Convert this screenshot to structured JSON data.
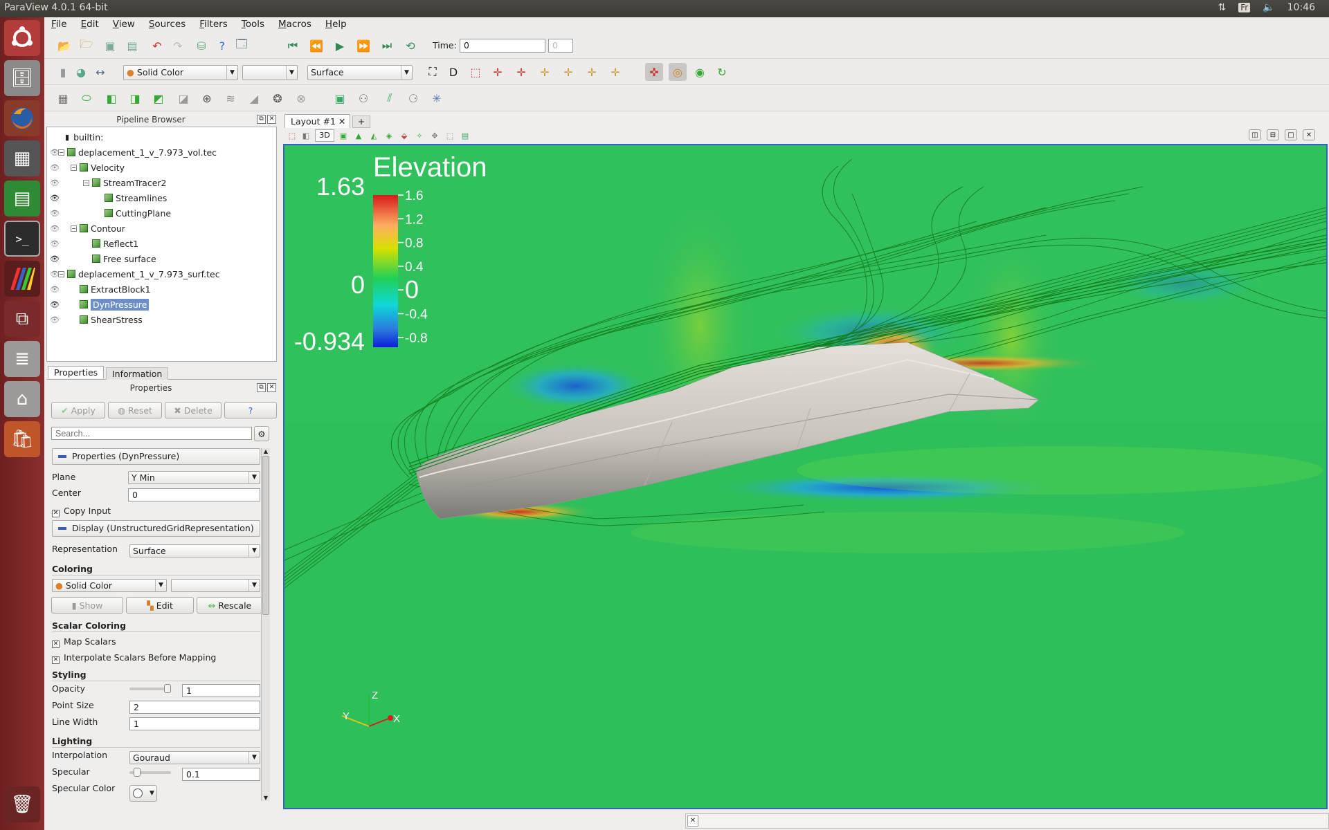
{
  "window_title": "ParaView 4.0.1 64-bit",
  "tray": {
    "network_icon": "updown-arrows-icon",
    "keyboard": "Fr",
    "volume_icon": "speaker-icon",
    "clock": "10:46"
  },
  "menu": [
    "File",
    "Edit",
    "View",
    "Sources",
    "Filters",
    "Tools",
    "Macros",
    "Help"
  ],
  "time": {
    "label": "Time:",
    "value": "0",
    "index": "0"
  },
  "toolbar2": {
    "coloring": "Solid Color",
    "component": "",
    "representation": "Surface"
  },
  "pipeline": {
    "title": "Pipeline Browser",
    "root": "builtin:",
    "items": [
      {
        "label": "deplacement_1_v_7.973_vol.tec",
        "visible": false
      },
      {
        "label": "Velocity",
        "visible": false
      },
      {
        "label": "StreamTracer2",
        "visible": false
      },
      {
        "label": "Streamlines",
        "visible": true
      },
      {
        "label": "CuttingPlane",
        "visible": false
      },
      {
        "label": "Contour",
        "visible": false
      },
      {
        "label": "Reflect1",
        "visible": false
      },
      {
        "label": "Free surface",
        "visible": true
      },
      {
        "label": "deplacement_1_v_7.973_surf.tec",
        "visible": false
      },
      {
        "label": "ExtractBlock1",
        "visible": false
      },
      {
        "label": "DynPressure",
        "visible": true,
        "selected": true
      },
      {
        "label": "ShearStress",
        "visible": false
      }
    ]
  },
  "panel_tabs": [
    "Properties",
    "Information"
  ],
  "properties": {
    "title": "Properties",
    "buttons": {
      "apply": "Apply",
      "reset": "Reset",
      "delete": "Delete",
      "help": "?"
    },
    "search_placeholder": "Search...",
    "section_props": "Properties (DynPressure)",
    "plane_label": "Plane",
    "plane_value": "Y Min",
    "center_label": "Center",
    "center_value": "0",
    "copy_input": "Copy Input",
    "section_display": "Display (UnstructuredGridRepresentation)",
    "representation_label": "Representation",
    "representation_value": "Surface",
    "coloring_header": "Coloring",
    "coloring_value": "Solid Color",
    "coloring_component": "",
    "show_label": "Show",
    "edit_label": "Edit",
    "rescale_label": "Rescale",
    "scalar_header": "Scalar Coloring",
    "map_scalars": "Map Scalars",
    "interpolate": "Interpolate Scalars Before Mapping",
    "styling_header": "Styling",
    "opacity_label": "Opacity",
    "opacity_value": "1",
    "opacity_level": 1,
    "pointsize_label": "Point Size",
    "pointsize_value": "2",
    "linewidth_label": "Line Width",
    "linewidth_value": "1",
    "lighting_header": "Lighting",
    "interp_label": "Interpolation",
    "interp_value": "Gouraud",
    "specular_label": "Specular",
    "specular_value": "0.1",
    "specular_level": 0.1,
    "specular_color_label": "Specular Color"
  },
  "layout_tab": {
    "label": "Layout #1",
    "add": "+",
    "mode_3d": "3D"
  },
  "legend": {
    "title": "Elevation",
    "max": "1.63",
    "mid": "0",
    "min": "-0.934",
    "ticks": [
      "1.6",
      "1.2",
      "0.8",
      "0.4",
      "0",
      "-0.4",
      "-0.8"
    ]
  },
  "axes": {
    "x": "X",
    "y": "Y",
    "z": "Z"
  },
  "colors": {
    "accent": "#3262c8",
    "selection": "#6d8fc9",
    "launcher": "#7a2626",
    "water": "#2fbf5a",
    "hull": "#cfcac3"
  }
}
